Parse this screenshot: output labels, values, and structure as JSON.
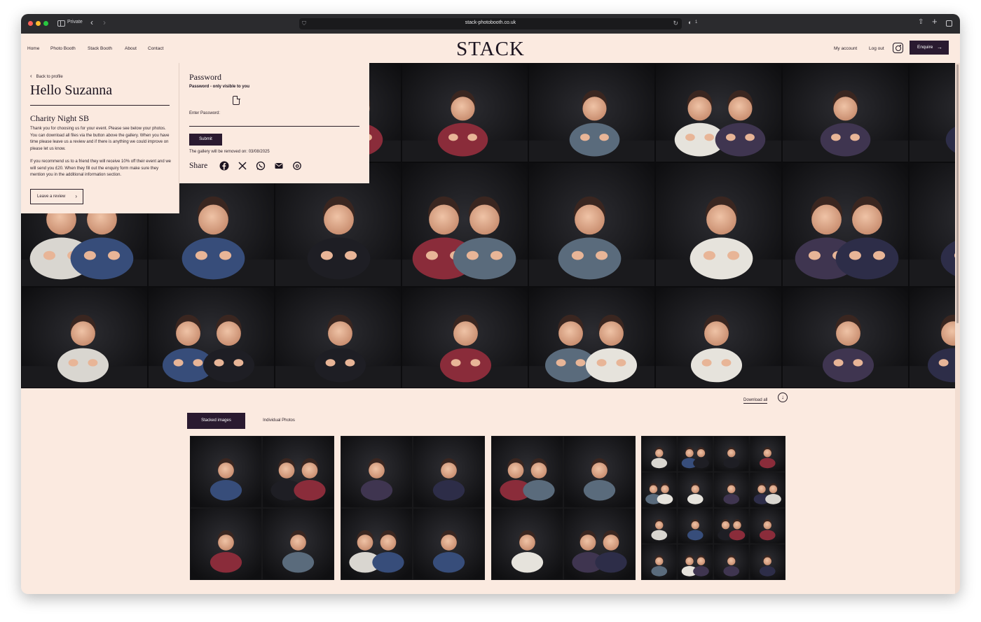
{
  "browser": {
    "private_label": "Private",
    "url": "stack-photobooth.co.uk",
    "extension_count": "1"
  },
  "nav": {
    "items": [
      "Home",
      "Photo Booth",
      "Stack Booth",
      "About",
      "Contact"
    ],
    "logo": "STACK",
    "my_account": "My account",
    "log_out": "Log out",
    "enquire": "Enquire"
  },
  "profile": {
    "back_label": "Back to profile",
    "greeting": "Hello Suzanna",
    "event_title": "Charity Night SB",
    "paragraph1": "Thank you for choosing us for your event. Please see below your photos. You can download all files via the button above the gallery. When you have time please leave us a review and if there is anything we could improve on please let us know.",
    "paragraph2": "If you recommend us to a friend they will receive 10% off their event and we will send you £20. When they fill out the enquiry form make sure they mention you in the additional information section.",
    "review_button": "Leave a review"
  },
  "password": {
    "title": "Password",
    "visibility_note": "Password - only visible to you",
    "input_label": "Enter Password:",
    "input_value": "",
    "submit": "Submit",
    "removal_note": "The gallery will be removed on: 03/08/2025"
  },
  "share": {
    "label": "Share",
    "icons": [
      "facebook-icon",
      "x-icon",
      "whatsapp-icon",
      "email-icon",
      "threads-icon"
    ]
  },
  "gallery": {
    "download_all": "Download all",
    "tabs": [
      "Stacked images",
      "Individual Photos"
    ],
    "active_tab": "Stacked images",
    "thumbnail_grids": [
      2,
      2,
      2,
      4
    ]
  },
  "colors": {
    "page_background": "#fbeae0",
    "accent_dark": "#2a1a30",
    "photo_background": "#121214"
  }
}
